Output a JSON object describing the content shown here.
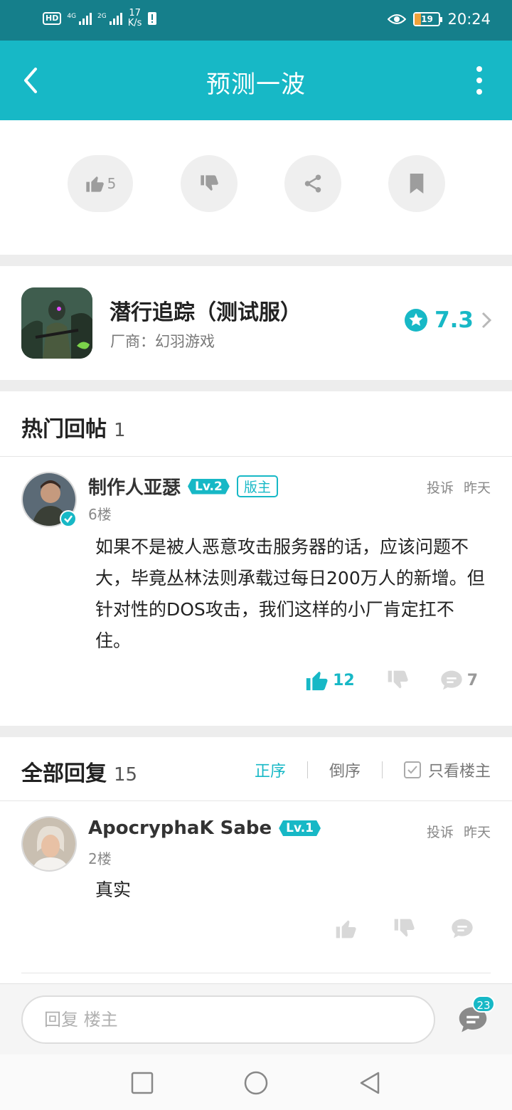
{
  "status_bar": {
    "network_label": "HD",
    "signal1": "4G",
    "signal2": "2G",
    "speed_value": "17",
    "speed_unit": "K/s",
    "battery": "19",
    "time": "20:24"
  },
  "header": {
    "title": "预测一波"
  },
  "actions": {
    "like_count": "5"
  },
  "game": {
    "name": "潜行追踪（测试服）",
    "developer": "厂商：幻羽游戏",
    "rating": "7.3"
  },
  "hot_section": {
    "title": "热门回帖",
    "count": "1"
  },
  "hot_post": {
    "username": "制作人亚瑟",
    "level": "Lv.2",
    "role_badge": "版主",
    "report": "投诉",
    "time": "昨天",
    "floor": "6楼",
    "content": "如果不是被人恶意攻击服务器的话，应该问题不大，毕竟丛林法则承载过每日200万人的新增。但针对性的DOS攻击，我们这样的小厂肯定扛不住。",
    "likes": "12",
    "comments": "7"
  },
  "all_section": {
    "title": "全部回复",
    "count": "15",
    "sort_asc": "正序",
    "sort_desc": "倒序",
    "owner_only": "只看楼主"
  },
  "reply_post": {
    "username": "ApocryphaK Sabe",
    "level": "Lv.1",
    "report": "投诉",
    "time": "昨天",
    "floor": "2楼",
    "content": "真实"
  },
  "reply_bar": {
    "placeholder": "回复 楼主",
    "comment_badge": "23"
  },
  "colors": {
    "accent": "#17b8c6",
    "status_bar": "#157f8b"
  },
  "icons": [
    "back-icon",
    "more-icon",
    "thumb-up-icon",
    "thumb-down-icon",
    "share-icon",
    "bookmark-icon",
    "star-icon",
    "chevron-right-icon",
    "comment-icon",
    "verified-icon",
    "checkbox-icon"
  ]
}
